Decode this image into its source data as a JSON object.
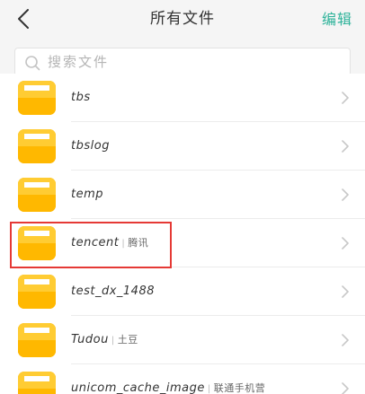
{
  "header": {
    "title": "所有文件",
    "edit_label": "编辑",
    "accent_color": "#2eb39a"
  },
  "search": {
    "placeholder": "搜索文件",
    "value": ""
  },
  "folders": [
    {
      "name": "tbs",
      "alias": ""
    },
    {
      "name": "tbslog",
      "alias": ""
    },
    {
      "name": "temp",
      "alias": ""
    },
    {
      "name": "tencent",
      "alias": "腾讯"
    },
    {
      "name": "test_dx_1488",
      "alias": ""
    },
    {
      "name": "Tudou",
      "alias": "土豆"
    },
    {
      "name": "unicom_cache_image",
      "alias": "联通手机营"
    }
  ],
  "icons": {
    "back": "chevron-left-icon",
    "search": "search-icon",
    "folder": "folder-icon",
    "row_arrow": "chevron-right-icon"
  },
  "highlight": {
    "target": "tencent",
    "color": "#e53935"
  }
}
